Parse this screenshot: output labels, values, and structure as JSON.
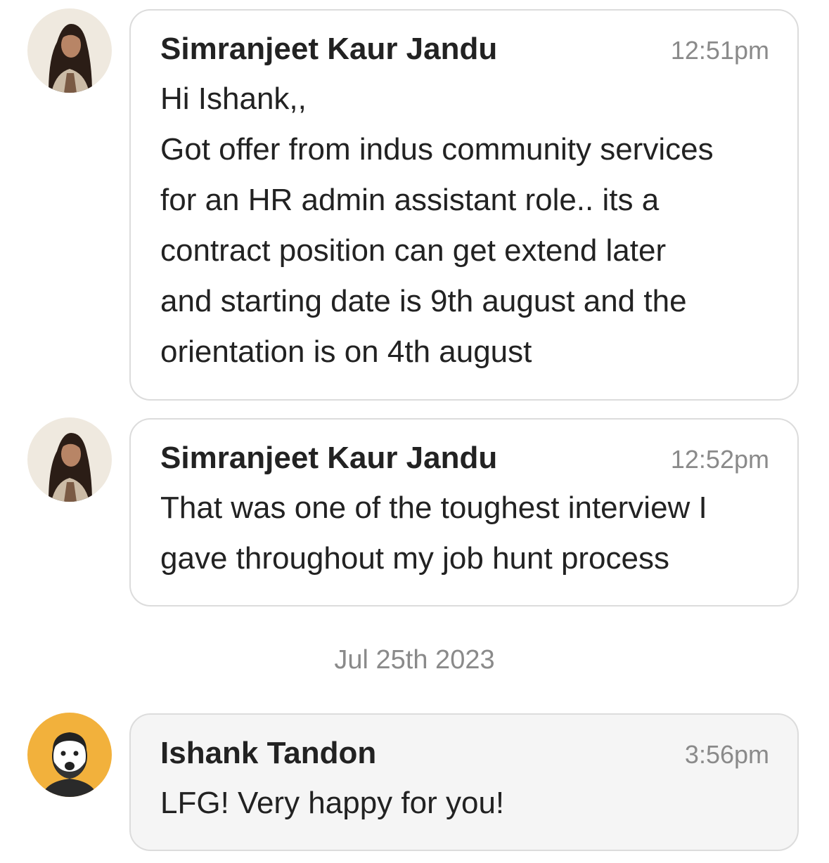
{
  "messages": [
    {
      "sender": "Simranjeet Kaur Jandu",
      "time": "12:51pm",
      "avatar": "profile-photo-woman",
      "lines": [
        "Hi Ishank,,",
        "Got offer from indus community services",
        "for an HR admin assistant role.. its a",
        "contract position can get extend later",
        "and starting date is 9th august and the",
        "orientation is on 4th august"
      ]
    },
    {
      "sender": "Simranjeet Kaur Jandu",
      "time": "12:52pm",
      "avatar": "profile-photo-woman",
      "lines": [
        "That was one of the toughest interview I",
        "gave throughout my job hunt process"
      ]
    },
    {
      "sender": "Ishank Tandon",
      "time": "3:56pm",
      "avatar": "profile-photo-man",
      "lines": [
        "LFG! Very happy for you!"
      ]
    }
  ],
  "date_separator": "Jul 25th 2023",
  "colors": {
    "bubble_border": "#dcdcdc",
    "own_bubble_bg": "#f5f5f5",
    "timestamp": "#8a8a8a",
    "text": "#222222",
    "avatar_yellow": "#f2b13c"
  }
}
